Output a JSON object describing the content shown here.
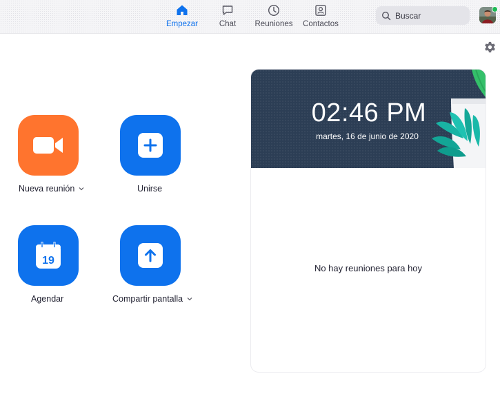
{
  "nav": {
    "items": [
      {
        "label": "Empezar",
        "icon": "home-icon",
        "active": true
      },
      {
        "label": "Chat",
        "icon": "chat-icon",
        "active": false
      },
      {
        "label": "Reuniones",
        "icon": "clock-icon",
        "active": false
      },
      {
        "label": "Contactos",
        "icon": "contacts-icon",
        "active": false
      }
    ],
    "active_color": "#0e72ed"
  },
  "search": {
    "placeholder": "Buscar",
    "icon": "search-icon"
  },
  "user": {
    "avatar": "avatar-photo",
    "status_color": "#1db954"
  },
  "settings": {
    "icon": "gear-icon"
  },
  "actions": [
    {
      "label": "Nueva reunión",
      "icon": "video-camera-icon",
      "color": "#ff742e",
      "has_dropdown": true
    },
    {
      "label": "Unirse",
      "icon": "plus-icon",
      "color": "#0e72ed",
      "has_dropdown": false
    },
    {
      "label": "Agendar",
      "icon": "calendar-icon",
      "calendar_day": "19",
      "color": "#0e72ed",
      "has_dropdown": false
    },
    {
      "label": "Compartir pantalla",
      "icon": "share-screen-up-arrow-icon",
      "color": "#0e72ed",
      "has_dropdown": true
    }
  ],
  "panel": {
    "time": "02:46 PM",
    "date": "martes, 16 de junio de 2020",
    "empty_message": "No hay reuniones para hoy",
    "banner_color": "#2c3e55"
  }
}
